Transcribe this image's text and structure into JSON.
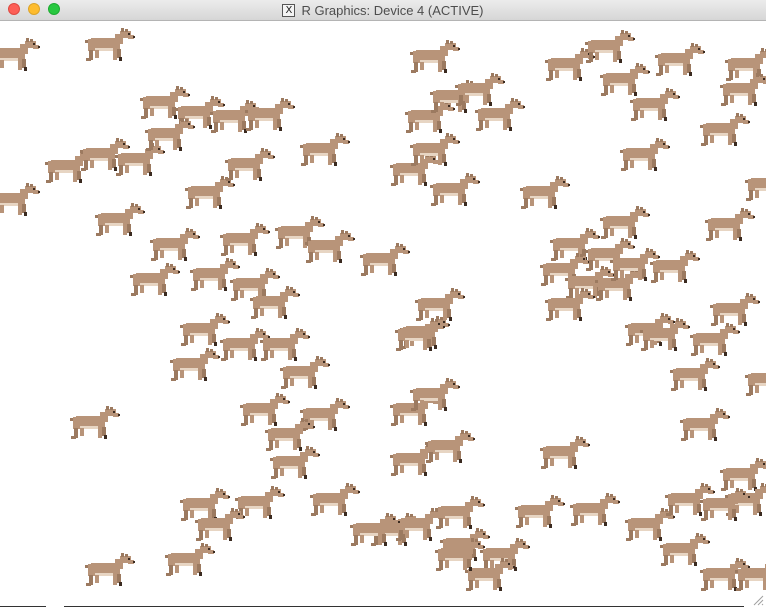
{
  "window": {
    "title": "R Graphics: Device 4 (ACTIVE)",
    "title_icon": "x11-icon",
    "controls": [
      "close",
      "minimize",
      "maximize"
    ]
  },
  "plot": {
    "background": "#ffffff",
    "sprite": "deer-icon",
    "colors": {
      "body": "#b89479",
      "shade": "#9c7a60",
      "belly": "#e7d5c3",
      "dark": "#3a2a20"
    },
    "deer_count": 120
  }
}
